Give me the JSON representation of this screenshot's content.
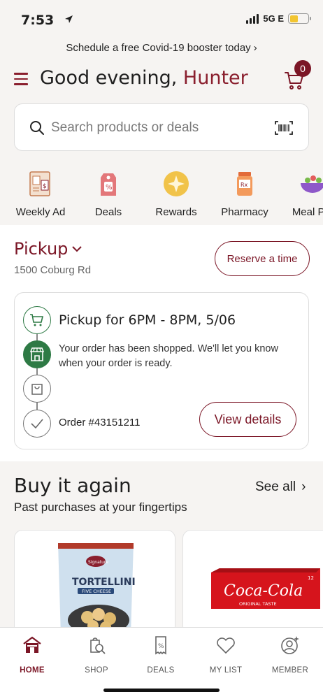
{
  "status_bar": {
    "time": "7:53",
    "network": "5G E",
    "battery_color": "#f2c531"
  },
  "promo": {
    "text": "Schedule a free Covid-19 booster today",
    "chevron": "›"
  },
  "header": {
    "greeting": "Good evening, ",
    "user_name": "Hunter",
    "cart_count": "0",
    "brand_color": "#7b1626"
  },
  "search": {
    "placeholder": "Search products or deals"
  },
  "categories": [
    {
      "label": "Weekly Ad",
      "icon": "weekly-ad-icon"
    },
    {
      "label": "Deals",
      "icon": "deals-tag-icon"
    },
    {
      "label": "Rewards",
      "icon": "rewards-star-icon"
    },
    {
      "label": "Pharmacy",
      "icon": "pharmacy-rx-icon"
    },
    {
      "label": "Meal Pla",
      "icon": "meal-plan-icon"
    }
  ],
  "pickup": {
    "title": "Pickup",
    "address": "1500 Coburg Rd",
    "reserve_label": "Reserve a time",
    "order": {
      "heading": "Pickup for 6PM - 8PM, 5/06",
      "message": "Your order has been shopped. We'll let you know when your order is ready.",
      "order_number": "Order #43151211",
      "view_details_label": "View details",
      "status_color": "#2e7a45"
    }
  },
  "buy_again": {
    "title": "Buy it again",
    "subtitle": "Past purchases at your fingertips",
    "see_all_label": "See all",
    "products": [
      {
        "brand": "Signature SELECT",
        "name": "TORTELLINI",
        "variant": "FIVE CHEESE"
      },
      {
        "brand": "Coca-Cola",
        "variant": "ORIGINAL TASTE",
        "count": "12"
      }
    ]
  },
  "tabs": [
    {
      "label": "HOME",
      "icon": "home-icon",
      "active": true
    },
    {
      "label": "SHOP",
      "icon": "shop-search-icon",
      "active": false
    },
    {
      "label": "DEALS",
      "icon": "deals-coupon-icon",
      "active": false
    },
    {
      "label": "MY LIST",
      "icon": "heart-icon",
      "active": false
    },
    {
      "label": "MEMBER",
      "icon": "member-icon",
      "active": false
    }
  ]
}
